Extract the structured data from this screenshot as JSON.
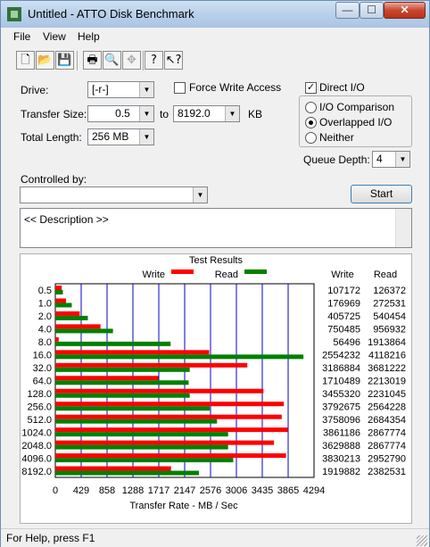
{
  "window": {
    "title": "Untitled - ATTO Disk Benchmark",
    "minimize_glyph": "—",
    "maximize_glyph": "☐",
    "close_glyph": "✕"
  },
  "menu": {
    "items": [
      "File",
      "View",
      "Help"
    ]
  },
  "toolbar": {
    "icons": [
      "new-icon",
      "open-icon",
      "save-icon",
      "print-icon",
      "print-preview-icon",
      "move-icon",
      "help-icon",
      "context-help-icon"
    ]
  },
  "form": {
    "drive_label": "Drive:",
    "drive_value": "[-r-]",
    "force_write_label": "Force Write Access",
    "force_write_checked": false,
    "direct_io_label": "Direct I/O",
    "direct_io_checked": true,
    "transfer_size_label": "Transfer Size:",
    "transfer_from": "0.5",
    "to_label": "to",
    "transfer_to": "8192.0",
    "kb_label": "KB",
    "total_length_label": "Total Length:",
    "total_length_value": "256 MB",
    "radio_io_comparison": "I/O Comparison",
    "radio_overlapped": "Overlapped I/O",
    "radio_neither": "Neither",
    "selected_mode": "Overlapped I/O",
    "queue_depth_label": "Queue Depth:",
    "queue_depth_value": "4",
    "controlled_by_label": "Controlled by:",
    "controlled_by_value": "",
    "start_label": "Start",
    "description_text": "<< Description >>"
  },
  "results": {
    "title": "Test Results",
    "write_col": "Write",
    "read_col": "Read"
  },
  "status": {
    "text": "For Help, press F1"
  },
  "colors": {
    "write": "#ff0000",
    "read": "#008000",
    "grid": "#0000cc"
  },
  "chart_data": {
    "type": "bar",
    "orientation": "horizontal",
    "title": "Test Results",
    "xlabel": "Transfer Rate - MB / Sec",
    "xlim": [
      0,
      4294
    ],
    "xticks": [
      "0",
      "429",
      "858",
      "1288",
      "1717",
      "2147",
      "2576",
      "3006",
      "3435",
      "3865",
      "4294"
    ],
    "categories": [
      "0.5",
      "1.0",
      "2.0",
      "4.0",
      "8.0",
      "16.0",
      "32.0",
      "64.0",
      "128.0",
      "256.0",
      "512.0",
      "1024.0",
      "2048.0",
      "4096.0",
      "8192.0"
    ],
    "series": [
      {
        "name": "Write",
        "color": "#ff0000",
        "values": [
          107,
          177,
          405,
          750,
          56,
          2554,
          3187,
          1710,
          3455,
          3793,
          3758,
          3861,
          3630,
          3830,
          1920
        ]
      },
      {
        "name": "Read",
        "color": "#008000",
        "values": [
          126,
          273,
          540,
          957,
          1914,
          4118,
          2231,
          2213,
          2231,
          2564,
          2684,
          2868,
          2868,
          2953,
          2383
        ]
      }
    ],
    "write_labels": [
      "107172",
      "176969",
      "405725",
      "750485",
      "56496",
      "2554232",
      "3186884",
      "1710489",
      "3455320",
      "3792675",
      "3758096",
      "3861186",
      "3629888",
      "3830213",
      "1919882"
    ],
    "read_labels": [
      "126372",
      "272531",
      "540454",
      "956932",
      "1913864",
      "4118216",
      "3681222",
      "2213019",
      "2231045",
      "2564228",
      "2684354",
      "2867774",
      "2867774",
      "2952790",
      "2382531"
    ]
  }
}
